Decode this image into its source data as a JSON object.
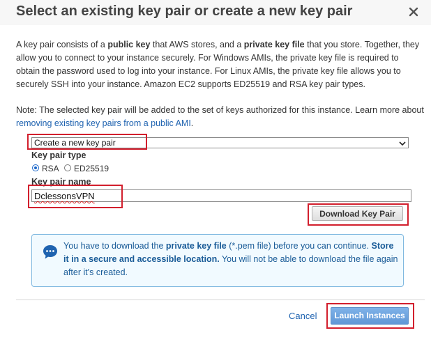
{
  "dialog": {
    "title": "Select an existing key pair or create a new key pair",
    "close_icon": "close-icon"
  },
  "intro": {
    "s1": "A key pair consists of a ",
    "b1": "public key",
    "s2": " that AWS stores, and a ",
    "b2": "private key file",
    "s3": " that you store. Together, they allow you to connect to your instance securely. For Windows AMIs, the private key file is required to obtain the password used to log into your instance. For Linux AMIs, the private key file allows you to securely SSH into your instance. Amazon EC2 supports ED25519 and RSA key pair types."
  },
  "note": {
    "text": "Note: The selected key pair will be added to the set of keys authorized for this instance. Learn more about ",
    "link": "removing existing key pairs from a public AMI",
    "end": "."
  },
  "key_pair_select": {
    "value": "Create a new key pair",
    "icon": "chevron-down-icon"
  },
  "key_pair_type": {
    "label": "Key pair type",
    "options": [
      "RSA",
      "ED25519"
    ],
    "selected": "RSA"
  },
  "key_pair_name": {
    "label": "Key pair name",
    "value": "DclessonsVPN"
  },
  "download_button": "Download Key Pair",
  "info": {
    "icon": "chat-info-icon",
    "t1": "You have to download the ",
    "b1": "private key file",
    "t2": " (*.pem file) before you can continue. ",
    "b2": "Store it in a secure and accessible location.",
    "t3": " You will not be able to download the file again after it's created."
  },
  "footer": {
    "cancel": "Cancel",
    "launch": "Launch Instances"
  },
  "colors": {
    "accent": "#1f63b0",
    "highlight": "#d21f2d",
    "info_bg": "#f1faff"
  }
}
